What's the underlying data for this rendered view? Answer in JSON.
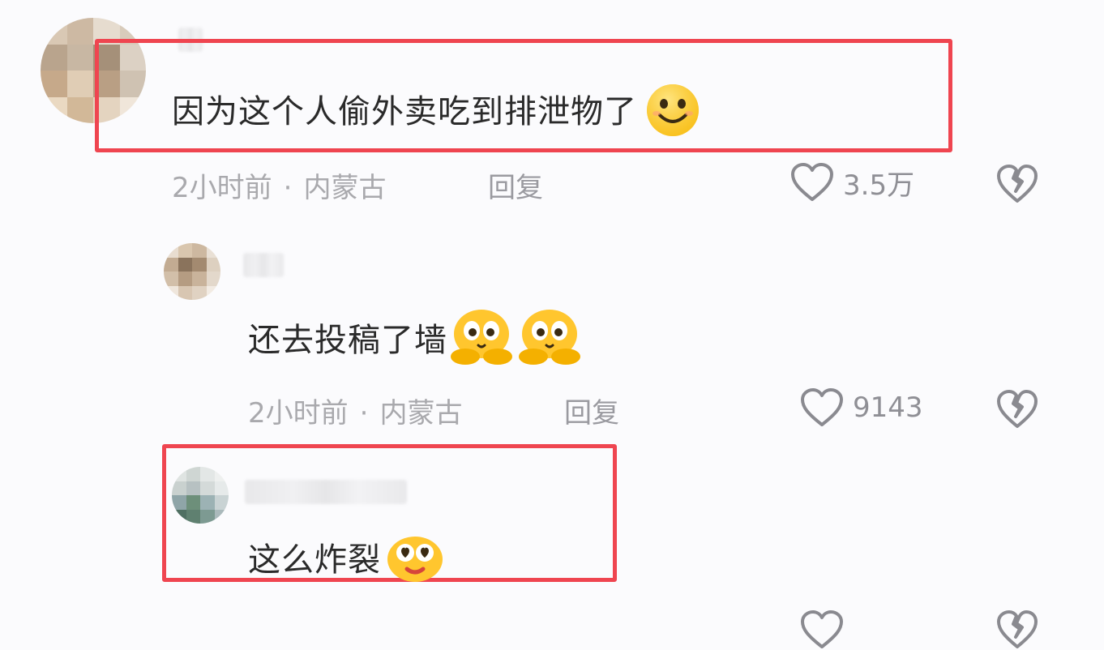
{
  "comments": [
    {
      "text": "因为这个人偷外卖吃到排泄物了",
      "emoji": "smile-emoji",
      "time": "2小时前",
      "separator": "·",
      "location": "内蒙古",
      "reply_label": "回复",
      "likes": "3.5万"
    },
    {
      "text": "还去投稿了墙",
      "emoji": "peeking-emoji",
      "time": "2小时前",
      "separator": "·",
      "location": "内蒙古",
      "reply_label": "回复",
      "likes": "9143"
    },
    {
      "text": "这么炸裂",
      "emoji": "heart-eyes-emoji"
    }
  ],
  "colors": {
    "highlight": "#ef4550",
    "meta_text": "#a9a9ad",
    "comment_text": "#2a2a2a"
  },
  "icons": [
    "heart-outline-icon",
    "broken-heart-icon"
  ]
}
